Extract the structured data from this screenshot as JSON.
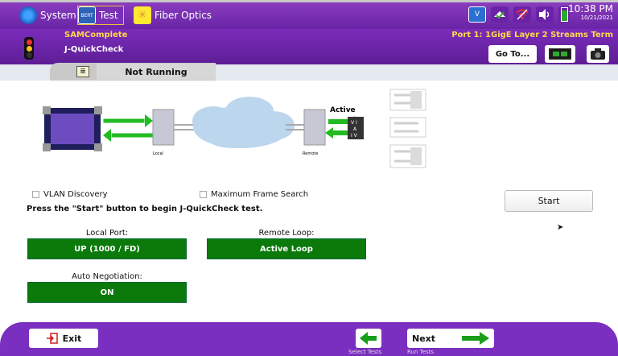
{
  "menu": {
    "system_label": "System",
    "test_label": "Test",
    "bert_icon_text": "BERT",
    "fiber_label": "Fiber Optics"
  },
  "clock": {
    "time": "10:38 PM",
    "date": "10/21/2021"
  },
  "header": {
    "app_title": "SAMComplete",
    "subtitle": "J-QuickCheck",
    "port": "Port 1: 1GigE Layer 2 Streams Term",
    "goto_label": "Go To..."
  },
  "status": {
    "text": "Not Running"
  },
  "diagram": {
    "local_label": "Local",
    "remote_label": "Remote",
    "active_label": "Active"
  },
  "options": {
    "vlan_discovery": "VLAN Discovery",
    "max_frame_search": "Maximum Frame Search"
  },
  "instruction": "Press the \"Start\" button to begin J-QuickCheck test.",
  "start_label": "Start",
  "fields": {
    "local_port_label": "Local Port:",
    "local_port_value": "UP (1000 / FD)",
    "remote_loop_label": "Remote Loop:",
    "remote_loop_value": "Active Loop",
    "auto_neg_label": "Auto Negotiation:",
    "auto_neg_value": "ON"
  },
  "footer": {
    "exit_label": "Exit",
    "select_tests_label": "Select Tests",
    "next_label": "Next",
    "run_tests_label": "Run Tests"
  },
  "colors": {
    "purple": "#7b2fc0",
    "status_green": "#0b7a0b",
    "accent_yellow": "#ffd94a"
  }
}
